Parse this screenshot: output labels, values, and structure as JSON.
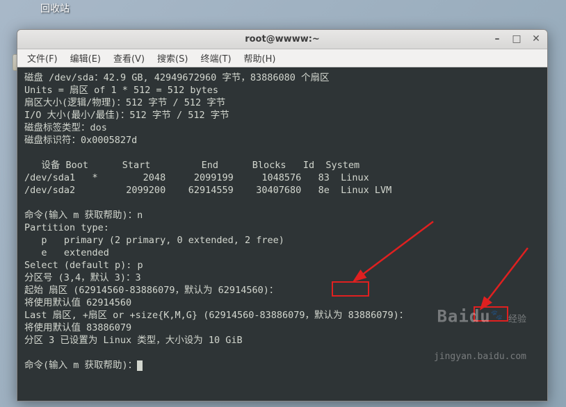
{
  "desktop": {
    "trash_label": "回收站"
  },
  "window": {
    "title": "root@wwww:~"
  },
  "menubar": {
    "items": [
      {
        "label": "文件(F)"
      },
      {
        "label": "编辑(E)"
      },
      {
        "label": "查看(V)"
      },
      {
        "label": "搜索(S)"
      },
      {
        "label": "终端(T)"
      },
      {
        "label": "帮助(H)"
      }
    ]
  },
  "terminal": {
    "l1": "磁盘 /dev/sda：42.9 GB, 42949672960 字节，83886080 个扇区",
    "l2": "Units = 扇区 of 1 * 512 = 512 bytes",
    "l3": "扇区大小(逻辑/物理)：512 字节 / 512 字节",
    "l4": "I/O 大小(最小/最佳)：512 字节 / 512 字节",
    "l5": "磁盘标签类型：dos",
    "l6": "磁盘标识符：0x0005827d",
    "l7": "",
    "l8": "   设备 Boot      Start         End      Blocks   Id  System",
    "l9": "/dev/sda1   *        2048     2099199     1048576   83  Linux",
    "l10": "/dev/sda2         2099200    62914559    30407680   8e  Linux LVM",
    "l11": "",
    "l12": "命令(输入 m 获取帮助)：n",
    "l13": "Partition type:",
    "l14": "   p   primary (2 primary, 0 extended, 2 free)",
    "l15": "   e   extended",
    "l16": "Select (default p): p",
    "l17": "分区号 (3,4，默认 3)：3",
    "l18": "起始 扇区 (62914560-83886079，默认为 62914560)：",
    "l19": "将使用默认值 62914560",
    "l20": "Last 扇区, +扇区 or +size{K,M,G} (62914560-83886079，默认为 83886079)：",
    "l21": "将使用默认值 83886079",
    "l22": "分区 3 已设置为 Linux 类型，大小设为 10 GiB",
    "l23": "",
    "l24": "命令(输入 m 获取帮助)："
  },
  "watermark": {
    "brand": "Baidu",
    "cn": "经验",
    "url": "jingyan.baidu.com"
  }
}
